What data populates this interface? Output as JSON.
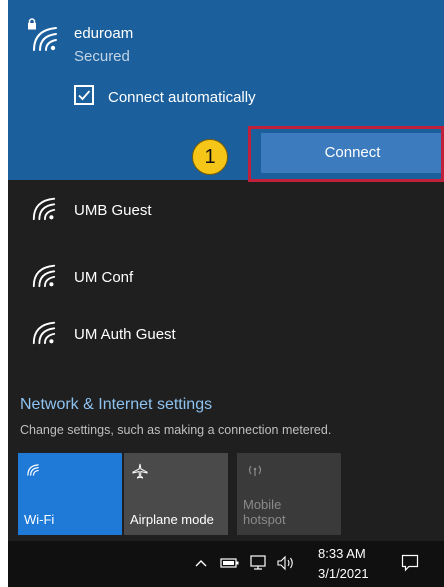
{
  "selected_network": {
    "name": "eduroam",
    "status": "Secured",
    "connect_automatically_label": "Connect automatically",
    "connect_automatically_checked": true,
    "connect_button_label": "Connect",
    "step_badge": "1"
  },
  "networks": [
    {
      "name": "UMB Guest",
      "icon": "wifi-icon"
    },
    {
      "name": "UM Conf",
      "icon": "wifi-icon"
    },
    {
      "name": "UM Auth Guest",
      "icon": "wifi-icon"
    }
  ],
  "settings": {
    "title": "Network & Internet settings",
    "subtitle": "Change settings, such as making a connection metered."
  },
  "quick_actions": [
    {
      "label": "Wi-Fi",
      "icon": "wifi-icon",
      "active": true
    },
    {
      "label": "Airplane mode",
      "icon": "airplane-icon",
      "active": false
    },
    {
      "label_line1": "Mobile",
      "label_line2": "hotspot",
      "icon": "hotspot-icon",
      "active": false,
      "disabled": true
    }
  ],
  "taskbar": {
    "time": "8:33 AM",
    "date": "3/1/2021",
    "tray_icons": [
      "chevron-up-icon",
      "battery-icon",
      "network-icon",
      "volume-icon",
      "notification-icon"
    ]
  },
  "colors": {
    "panel_background": "#1f1f1f",
    "selected_background": "#1b5f9c",
    "connect_button": "#3c7bbd",
    "highlight_border": "#c1203b",
    "badge_fill": "#f5c518",
    "link": "#8ec2f0",
    "wifi_tile_active": "#1e7ad6"
  }
}
